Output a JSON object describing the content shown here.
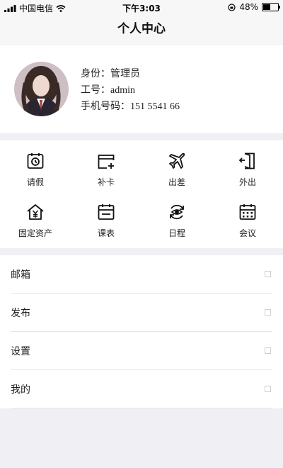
{
  "status_bar": {
    "carrier": "中国电信",
    "time": "下午3:03",
    "battery": "48%",
    "battery_level": 0.48
  },
  "header": {
    "title": "个人中心"
  },
  "profile": {
    "identity_label": "身份：",
    "identity_value": "管理员",
    "id_label": "工号：",
    "id_value": "admin",
    "phone_label": "手机号码：",
    "phone_value": "151 5541 66"
  },
  "grid": {
    "items": [
      {
        "label": "请假",
        "icon": "clock-calendar-icon"
      },
      {
        "label": "补卡",
        "icon": "card-add-icon"
      },
      {
        "label": "出差",
        "icon": "airplane-icon"
      },
      {
        "label": "外出",
        "icon": "exit-door-icon"
      },
      {
        "label": "固定资产",
        "icon": "house-yen-icon"
      },
      {
        "label": "课表",
        "icon": "schedule-list-icon"
      },
      {
        "label": "日程",
        "icon": "eye-refresh-icon"
      },
      {
        "label": "会议",
        "icon": "calendar-grid-icon"
      }
    ]
  },
  "menu": {
    "items": [
      {
        "label": "邮箱"
      },
      {
        "label": "发布"
      },
      {
        "label": "设置"
      },
      {
        "label": "我的"
      }
    ]
  }
}
